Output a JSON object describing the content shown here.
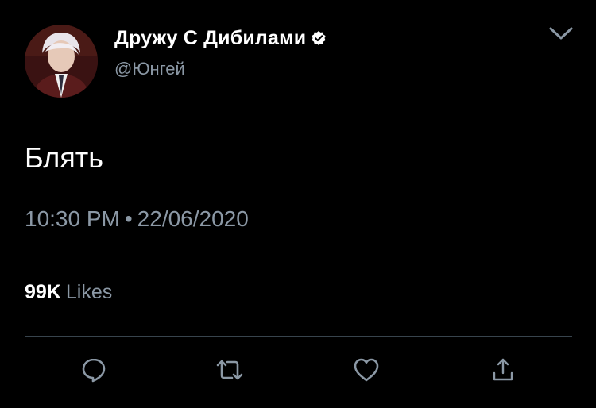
{
  "author": {
    "display_name": "Дружу С Дибилами",
    "handle": "@Юнгей",
    "verified": true
  },
  "tweet": {
    "text": "Блять",
    "time": "10:30 PM",
    "separator": "•",
    "date": "22/06/2020"
  },
  "stats": {
    "likes_count": "99K",
    "likes_label": "Likes"
  },
  "icons": {
    "menu": "chevron-down-icon",
    "reply": "reply-icon",
    "retweet": "retweet-icon",
    "like": "heart-icon",
    "share": "share-icon",
    "verified": "verified-badge-icon"
  },
  "colors": {
    "background": "#000000",
    "text_primary": "#ffffff",
    "text_secondary": "#8b98a5",
    "divider": "#38444d"
  }
}
